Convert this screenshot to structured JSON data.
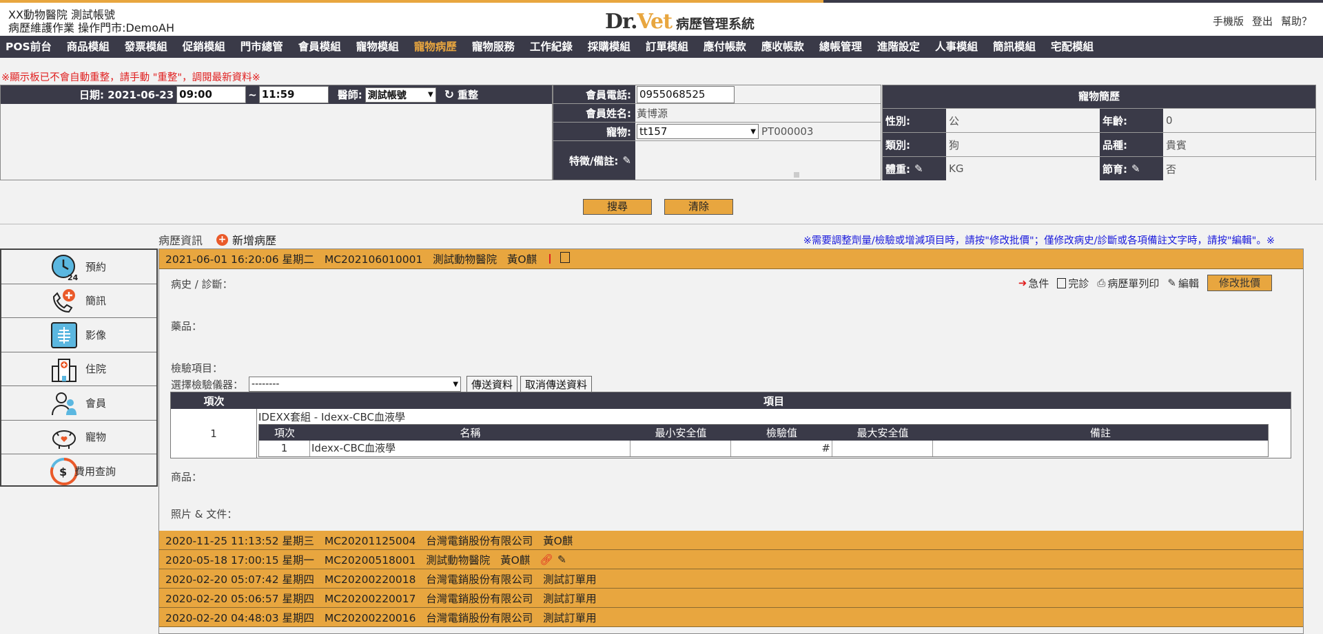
{
  "header": {
    "clinic_line": "XX動物醫院 測試帳號",
    "sub_line": "病歷維護作業 操作門市:DemoAH",
    "logo_dr": "Dr.",
    "logo_vet": "Vet",
    "system_title": "病歷管理系統",
    "links": [
      "手機版",
      "登出",
      "幫助？"
    ]
  },
  "nav": {
    "items": [
      "POS前台",
      "商品模組",
      "發票模組",
      "促銷模組",
      "門市總管",
      "會員模組",
      "寵物模組",
      "寵物病歷",
      "寵物服務",
      "工作紀錄",
      "採購模組",
      "訂單模組",
      "應付帳款",
      "應收帳款",
      "總帳管理",
      "進階設定",
      "人事模組",
      "簡訊模組",
      "宅配模組"
    ],
    "active": "寵物病歷"
  },
  "warning": "※顯示板已不會自動重整，請手動 \"重整\"，調閱最新資料※",
  "filter": {
    "date_label": "日期: 2021-06-23",
    "time_from": "09:00",
    "tilde": "~",
    "time_to": "11:59",
    "doctor_label": "醫師:",
    "doctor_value": "測試帳號",
    "refresh_label": "重整"
  },
  "member": {
    "phone_label": "會員電話:",
    "phone_value": "0955068525",
    "name_label": "會員姓名:",
    "name_value": "黃博源",
    "pet_label": "寵物:",
    "pet_value": "tt157",
    "pet_code": "PT000003",
    "note_label": "特徵/備註:"
  },
  "pet_profile": {
    "title": "寵物簡歷",
    "gender_label": "性別:",
    "gender_value": "公",
    "age_label": "年齡:",
    "age_value": "0",
    "type_label": "類別:",
    "type_value": "狗",
    "breed_label": "品種:",
    "breed_value": "貴賓",
    "weight_label": "體重:",
    "weight_value": "KG",
    "neuter_label": "節育:",
    "neuter_value": "否"
  },
  "actions": {
    "search": "搜尋",
    "clear": "清除"
  },
  "records_section": {
    "title": "病歷資訊",
    "add_label": "新增病歷",
    "notice": "※需要調整劑量/檢驗或增減項目時，請按\"修改批價\"；僅修改病史/診斷或各項備註文字時，請按\"編輯\"。※"
  },
  "sidebar": {
    "items": [
      {
        "label": "預約",
        "icon": "clock-24-icon"
      },
      {
        "label": "簡訊",
        "icon": "phone-sms-icon"
      },
      {
        "label": "影像",
        "icon": "xray-icon"
      },
      {
        "label": "住院",
        "icon": "hospital-icon"
      },
      {
        "label": "會員",
        "icon": "members-icon"
      },
      {
        "label": "寵物",
        "icon": "piggy-pet-icon"
      },
      {
        "label": "費用查詢",
        "icon": "fee-dollar-icon"
      }
    ]
  },
  "open_record": {
    "header": "2021-06-01 16:20:06 星期二   MC202106010001   測試動物醫院   黃O麒",
    "toolbar": {
      "urgent": "急件",
      "done": "完診",
      "print": "病歷單列印",
      "edit": "編輯",
      "reprice": "修改批價"
    },
    "history_label": "病史 / 診斷：",
    "drugs_label": "藥品：",
    "tests_label": "檢驗項目：",
    "instrument_label": "選擇檢驗儀器：",
    "instrument_value": "--------",
    "send_btn": "傳送資料",
    "cancel_send_btn": "取消傳送資料",
    "table": {
      "col_no": "項次",
      "col_item": "項目",
      "row_no": "1",
      "group_name": "IDEXX套組 - Idexx-CBC血液學",
      "inner_headers": [
        "項次",
        "名稱",
        "最小安全值",
        "檢驗值",
        "最大安全值",
        "備註"
      ],
      "inner_row": [
        "1",
        "Idexx-CBC血液學",
        "",
        "#",
        "",
        ""
      ]
    },
    "goods_label": "商品：",
    "photos_label": "照片 & 文件："
  },
  "other_records": [
    "2020-11-25 11:13:52 星期三   MC20201125004   台灣電銷股份有限公司   黃O麒",
    "2020-05-18 17:00:15 星期一   MC20200518001   測試動物醫院   黃O麒",
    "2020-02-20 05:07:42 星期四   MC20200220018   台灣電銷股份有限公司   測試訂單用",
    "2020-02-20 05:06:57 星期四   MC20200220017   台灣電銷股份有限公司   測試訂單用",
    "2020-02-20 04:48:03 星期四   MC20200220016   台灣電銷股份有限公司   測試訂單用"
  ],
  "colors": {
    "accent": "#e8a63f",
    "dark": "#3a3a48",
    "warn": "#e02020",
    "notice": "#1a1adc"
  }
}
